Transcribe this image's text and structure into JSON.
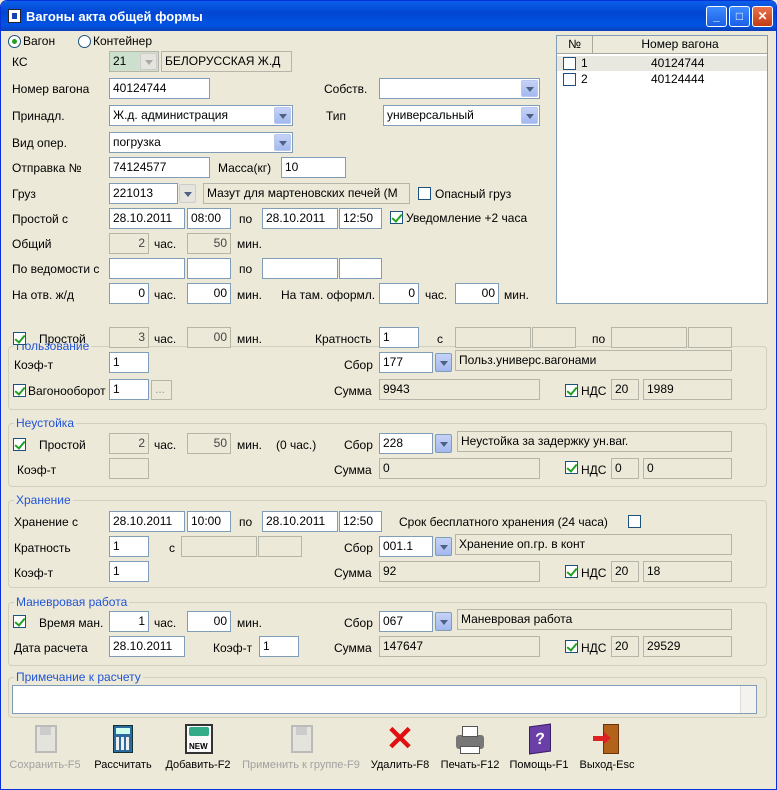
{
  "window": {
    "title": "Вагоны акта общей формы"
  },
  "mode": {
    "wagon_label": "Вагон",
    "container_label": "Контейнер"
  },
  "ks": {
    "label": "КС",
    "code": "21",
    "name": "БЕЛОРУССКАЯ Ж.Д"
  },
  "wagon_number": {
    "label": "Номер вагона",
    "value": "40124744"
  },
  "owner": {
    "label": "Собств.",
    "value": ""
  },
  "belongs": {
    "label": "Принадл.",
    "value": "Ж.д. администрация"
  },
  "type": {
    "label": "Тип",
    "value": "универсальный"
  },
  "operation": {
    "label": "Вид опер.",
    "value": "погрузка"
  },
  "shipment": {
    "label": "Отправка №",
    "value": "74124577"
  },
  "mass": {
    "label": "Масса(кг)",
    "value": "10"
  },
  "cargo": {
    "label": "Груз",
    "code": "221013",
    "name": "Мазут для мартеновских печей (М",
    "dangerous_label": "Опасный груз"
  },
  "idle": {
    "label": "Простой с",
    "date_from": "28.10.2011",
    "time_from": "08:00",
    "to_label": "по",
    "date_to": "28.10.2011",
    "time_to": "12:50",
    "notify_label": "Уведомление +2 часа"
  },
  "total": {
    "label": "Общий",
    "hours": "2",
    "hours_unit": "час.",
    "minutes": "50",
    "minutes_unit": "мин."
  },
  "by_statement": {
    "label": "По ведомости с",
    "to_label": "по"
  },
  "on_rail": {
    "label": "На отв. ж/д",
    "hours": "0",
    "hours_unit": "час.",
    "minutes": "00",
    "minutes_unit": "мин.",
    "customs_label": "На там. оформл.",
    "customs_hours": "0",
    "customs_minutes": "00"
  },
  "grid": {
    "col_num": "№",
    "col_wagon": "Номер вагона",
    "rows": [
      {
        "n": "1",
        "wagon": "40124744"
      },
      {
        "n": "2",
        "wagon": "40124444"
      }
    ]
  },
  "usage": {
    "title": "Пользование",
    "idle_label": "Простой",
    "hours": "3",
    "hours_unit": "час.",
    "minutes": "00",
    "minutes_unit": "мин.",
    "mult_label": "Кратность",
    "mult": "1",
    "from_label": "с",
    "to_label": "по",
    "coef_label": "Коэф-т",
    "coef": "1",
    "fee_label": "Сбор",
    "fee": "177",
    "fee_name": "Польз.универс.вагонами",
    "turnover_label": "Вагонооборот",
    "turnover": "1",
    "turnover_btn": "...",
    "sum_label": "Сумма",
    "sum": "9943",
    "vat_label": "НДС",
    "vat_rate": "20",
    "vat_sum": "1989"
  },
  "penalty": {
    "title": "Неустойка",
    "idle_label": "Простой",
    "hours": "2",
    "hours_unit": "час.",
    "minutes": "50",
    "minutes_unit": "мин.",
    "note": "(0 час.)",
    "fee_label": "Сбор",
    "fee": "228",
    "fee_name": "Неустойка за задержку ун.ваг.",
    "coef_label": "Коэф-т",
    "coef": "",
    "sum_label": "Сумма",
    "sum": "0",
    "vat_label": "НДС",
    "vat_rate": "0",
    "vat_sum": "0"
  },
  "storage": {
    "title": "Хранение",
    "from_label": "Хранение с",
    "date_from": "28.10.2011",
    "time_from": "10:00",
    "to_label": "по",
    "date_to": "28.10.2011",
    "time_to": "12:50",
    "free_label": "Срок бесплатного хранения (24 часа)",
    "mult_label": "Кратность",
    "mult": "1",
    "c_label": "с",
    "fee_label": "Сбор",
    "fee": "001.1",
    "fee_name": "Хранение оп.гр. в конт",
    "coef_label": "Коэф-т",
    "coef": "1",
    "sum_label": "Сумма",
    "sum": "92",
    "vat_label": "НДС",
    "vat_rate": "20",
    "vat_sum": "18"
  },
  "shunting": {
    "title": "Маневровая работа",
    "time_label": "Время ман.",
    "hours": "1",
    "hours_unit": "час.",
    "minutes": "00",
    "minutes_unit": "мин.",
    "fee_label": "Сбор",
    "fee": "067",
    "fee_name": "Маневровая работа",
    "calc_date_label": "Дата расчета",
    "calc_date": "28.10.2011",
    "coef_label": "Коэф-т",
    "coef": "1",
    "sum_label": "Сумма",
    "sum": "147647",
    "vat_label": "НДС",
    "vat_rate": "20",
    "vat_sum": "29529"
  },
  "note": {
    "title": "Примечание к расчету",
    "value": ""
  },
  "toolbar": {
    "save": "Сохранить-F5",
    "calc": "Рассчитать",
    "add": "Добавить-F2",
    "apply": "Применить к группе-F9",
    "delete": "Удалить-F8",
    "print": "Печать-F12",
    "help": "Помощь-F1",
    "exit": "Выход-Esc",
    "new_icon_text": "NEW"
  }
}
